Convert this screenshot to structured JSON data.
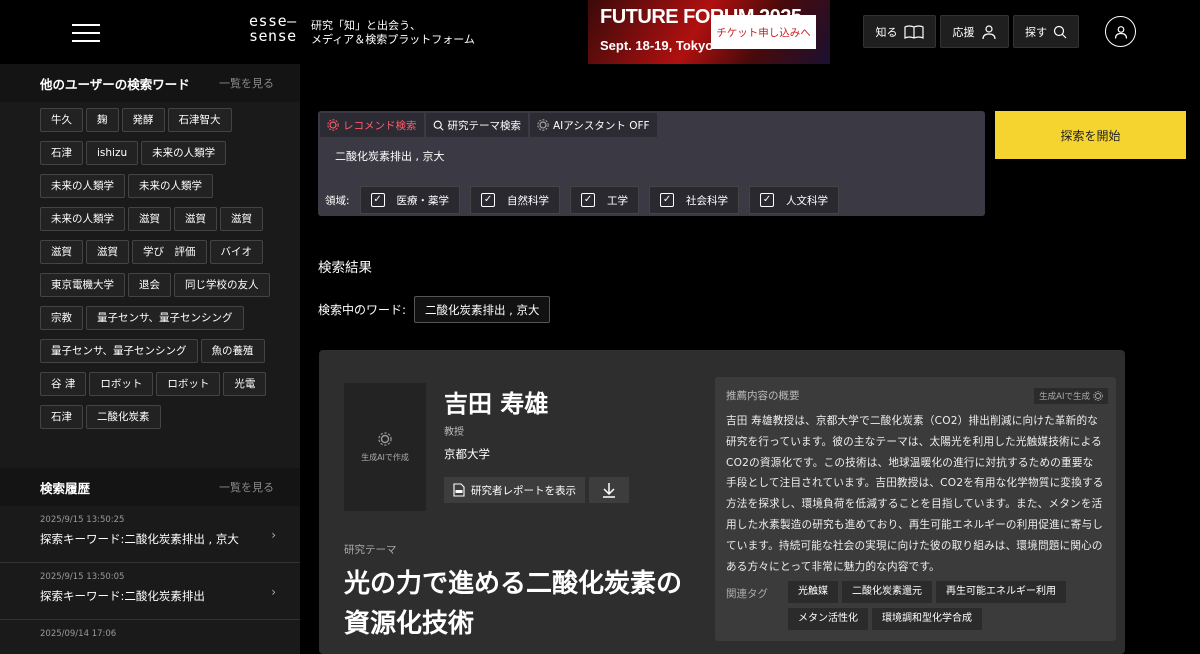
{
  "header": {
    "logo_line1": "esse—",
    "logo_line2": "sense",
    "tagline_line1": "研究「知」と出会う、",
    "tagline_line2": "メディア＆検索プラットフォーム",
    "banner_title": "FUTURE FORUM 2025",
    "banner_date": "Sept. 18-19, Tokyo",
    "ticket_label": "チケット申し込みへ",
    "nav": [
      {
        "label": "知る",
        "icon": "book-icon"
      },
      {
        "label": "応援",
        "icon": "support-icon"
      },
      {
        "label": "探す",
        "icon": "search-icon"
      }
    ]
  },
  "sidebar": {
    "keywords_title": "他のユーザーの検索ワード",
    "keywords_more": "一覧を見る",
    "keywords": [
      "牛久",
      "麹",
      "発酵",
      "石津智大",
      "石津",
      "ishizu",
      "未来の人類学",
      "未来の人類学",
      "未来の人類学",
      "未来の人類学",
      "滋賀",
      "滋賀",
      "滋賀",
      "滋賀",
      "滋賀",
      "学び　評価",
      "バイオ",
      "東京電機大学",
      "退会",
      "同じ学校の友人",
      "宗教",
      "量子センサ、量子センシング",
      "量子センサ、量子センシング",
      "魚の養殖",
      "谷 津",
      "ロボット",
      "ロボット",
      "光電",
      "石津",
      "二酸化炭素"
    ],
    "history_title": "検索履歴",
    "history_more": "一覧を見る",
    "history": [
      {
        "date": "2025/9/15 13:50:25",
        "text": "探索キーワード:二酸化炭素排出 , 京大"
      },
      {
        "date": "2025/9/15 13:50:05",
        "text": "探索キーワード:二酸化炭素排出"
      },
      {
        "date": "2025/09/14 17:06",
        "text": ""
      }
    ]
  },
  "search": {
    "tabs": [
      {
        "label": "レコメンド検索",
        "active": true
      },
      {
        "label": "研究テーマ検索",
        "active": false
      },
      {
        "label": "AIアシスタント OFF",
        "active": false
      }
    ],
    "query": "二酸化炭素排出 , 京大",
    "field_label": "領域:",
    "fields": [
      "医療・薬学",
      "自然科学",
      "工学",
      "社会科学",
      "人文科学"
    ],
    "start_label": "探索を開始"
  },
  "results": {
    "title": "検索結果",
    "word_label": "検索中のワード:",
    "word_value": "二酸化炭素排出 , 京大"
  },
  "card": {
    "photo_label": "生成AIで作成",
    "name": "吉田 寿雄",
    "role": "教授",
    "university": "京都大学",
    "report_label": "研究者レポートを表示",
    "theme_label": "研究テーマ",
    "theme": "光の力で進める二酸化炭素の資源化技術",
    "summary_title": "推薦内容の概要",
    "summary_badge": "生成AIで生成",
    "summary": "吉田 寿雄教授は、京都大学で二酸化炭素（CO2）排出削減に向けた革新的な研究を行っています。彼の主なテーマは、太陽光を利用した光触媒技術によるCO2の資源化です。この技術は、地球温暖化の進行に対抗するための重要な手段として注目されています。吉田教授は、CO2を有用な化学物質に変換する方法を探求し、環境負荷を低減することを目指しています。また、メタンを活用した水素製造の研究も進めており、再生可能エネルギーの利用促進に寄与しています。持続可能な社会の実現に向けた彼の取り組みは、環境問題に関心のある方々にとって非常に魅力的な内容です。",
    "related_label": "関連タグ",
    "related_tags": [
      "光触媒",
      "二酸化炭素還元",
      "再生可能エネルギー利用",
      "メタン活性化",
      "環境調和型化学合成"
    ]
  }
}
